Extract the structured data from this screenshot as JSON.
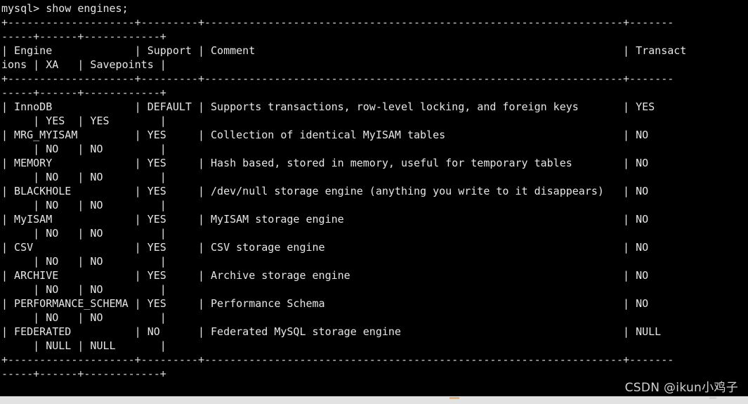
{
  "terminal": {
    "prompt_line": "mysql> show engines;",
    "columns": 106,
    "background_color": "#000000",
    "text_color": "#e6e6e6",
    "rule_color": "#d8d8d8",
    "separator_full": "+--------------------+---------+----------------------------------------------------------------+--------------+------+------------+",
    "header_cells": [
      "Engine",
      "Support",
      "Comment",
      "Transactions",
      "XA",
      "Savepoints"
    ],
    "header_line": "| Engine             | Support | Comment                                                        | Transactions | XA   | Savepoints |",
    "rows": [
      {
        "engine": "InnoDB",
        "support": "DEFAULT",
        "comment": "Supports transactions, row-level locking, and foreign keys",
        "transactions": "YES",
        "xa": "YES",
        "savepoints": "YES",
        "line": "| InnoDB             | DEFAULT | Supports transactions, row-level locking, and foreign keys     | YES          | YES  | YES        |"
      },
      {
        "engine": "MRG_MYISAM",
        "support": "YES",
        "comment": "Collection of identical MyISAM tables",
        "transactions": "NO",
        "xa": "NO",
        "savepoints": "NO",
        "line": "| MRG_MYISAM         | YES     | Collection of identical MyISAM tables                          | NO           | NO   | NO         |"
      },
      {
        "engine": "MEMORY",
        "support": "YES",
        "comment": "Hash based, stored in memory, useful for temporary tables",
        "transactions": "NO",
        "xa": "NO",
        "savepoints": "NO",
        "line": "| MEMORY             | YES     | Hash based, stored in memory, useful for temporary tables      | NO           | NO   | NO         |"
      },
      {
        "engine": "BLACKHOLE",
        "support": "YES",
        "comment": "/dev/null storage engine (anything you write to it disappears)",
        "transactions": "NO",
        "xa": "NO",
        "savepoints": "NO",
        "line": "| BLACKHOLE          | YES     | /dev/null storage engine (anything you write to it disappears) | NO           | NO   | NO         |"
      },
      {
        "engine": "MyISAM",
        "support": "YES",
        "comment": "MyISAM storage engine",
        "transactions": "NO",
        "xa": "NO",
        "savepoints": "NO",
        "line": "| MyISAM             | YES     | MyISAM storage engine                                          | NO           | NO   | NO         |"
      },
      {
        "engine": "CSV",
        "support": "YES",
        "comment": "CSV storage engine",
        "transactions": "NO",
        "xa": "NO",
        "savepoints": "NO",
        "line": "| CSV                | YES     | CSV storage engine                                             | NO           | NO   | NO         |"
      },
      {
        "engine": "ARCHIVE",
        "support": "YES",
        "comment": "Archive storage engine",
        "transactions": "NO",
        "xa": "NO",
        "savepoints": "NO",
        "line": "| ARCHIVE            | YES     | Archive storage engine                                         | NO           | NO   | NO         |"
      },
      {
        "engine": "PERFORMANCE_SCHEMA",
        "support": "YES",
        "comment": "Performance Schema",
        "transactions": "NO",
        "xa": "NO",
        "savepoints": "NO",
        "line": "| PERFORMANCE_SCHEMA | YES     | Performance Schema                                             | NO           | NO   | NO         |"
      },
      {
        "engine": "FEDERATED",
        "support": "NO",
        "comment": "Federated MySQL storage engine",
        "transactions": "NULL",
        "xa": "NULL",
        "savepoints": "NULL",
        "line": "| FEDERATED          | NO      | Federated MySQL storage engine                                 | NULL         | NULL | NULL       |"
      }
    ],
    "wrapped_lines": [
      "mysql> show engines;",
      "+--------------------+---------+-------------------------------------------------------",
      "-----+--------------+------+------------+",
      "| Engine             | Support | Comment                                                ",
      "ions | XA   | Savepoints |",
      "+--------------------+---------+-------------------------------------------------------",
      "-----+--------------+------+------------+",
      "| InnoDB             | DEFAULT | Supports transactions, row-level locking, and foreign k",
      "    | YES  | YES        |",
      "| MRG_MYISAM         | YES     | Collection of identical MyISAM tables                  ",
      "    | NO   | NO         |",
      "| MEMORY             | YES     | Hash based, stored in memory, useful for temporary tabl",
      "    | NO   | NO         |",
      "| BLACKHOLE          | YES     | /dev/null storage engine (anything you write to it disa",
      "    | NO   | NO         |",
      "| MyISAM             | YES     | MyISAM storage engine                                  ",
      "    | NO   | NO         |",
      "| CSV                | YES     | CSV storage engine                                     ",
      "    | NO   | NO         |",
      "| ARCHIVE            | YES     | Archive storage engine                                 ",
      "    | NO   | NO         |",
      "| PERFORMANCE_SCHEMA | YES     | Performance Schema                                     ",
      "    | NO   | NO         |",
      "| FEDERATED          | NO      | Federated MySQL storage engine                         ",
      "    | NULL | NULL       |",
      "+--------------------+---------+-------------------------------------------------------",
      "-----+--------------+------+------------+"
    ],
    "display_lines": [
      {
        "id": "line-prompt",
        "text": "mysql> show engines;",
        "kind": "prompt"
      },
      {
        "id": "line-rule-top-a",
        "text": "+--------------------+---------+------------------------------------------------------------------+-------",
        "kind": "rule"
      },
      {
        "id": "line-rule-top-b",
        "text": "-----+------+------------+",
        "kind": "rule"
      },
      {
        "id": "line-head-a",
        "text": "| Engine             | Support | Comment                                                          | Transact",
        "kind": "text"
      },
      {
        "id": "line-head-b",
        "text": "ions | XA   | Savepoints |",
        "kind": "text"
      },
      {
        "id": "line-rule-mid-a",
        "text": "+--------------------+---------+------------------------------------------------------------------+-------",
        "kind": "rule"
      },
      {
        "id": "line-rule-mid-b",
        "text": "-----+------+------------+",
        "kind": "rule"
      },
      {
        "id": "line-innodb-a",
        "text": "| InnoDB             | DEFAULT | Supports transactions, row-level locking, and foreign keys       | YES",
        "kind": "text"
      },
      {
        "id": "line-innodb-b",
        "text": "     | YES  | YES        |",
        "kind": "text"
      },
      {
        "id": "line-mrg-a",
        "text": "| MRG_MYISAM         | YES     | Collection of identical MyISAM tables                            | NO",
        "kind": "text"
      },
      {
        "id": "line-mrg-b",
        "text": "     | NO   | NO         |",
        "kind": "text"
      },
      {
        "id": "line-memory-a",
        "text": "| MEMORY             | YES     | Hash based, stored in memory, useful for temporary tables        | NO",
        "kind": "text"
      },
      {
        "id": "line-memory-b",
        "text": "     | NO   | NO         |",
        "kind": "text"
      },
      {
        "id": "line-blackhole-a",
        "text": "| BLACKHOLE          | YES     | /dev/null storage engine (anything you write to it disappears)   | NO",
        "kind": "text"
      },
      {
        "id": "line-blackhole-b",
        "text": "     | NO   | NO         |",
        "kind": "text"
      },
      {
        "id": "line-myisam-a",
        "text": "| MyISAM             | YES     | MyISAM storage engine                                            | NO",
        "kind": "text"
      },
      {
        "id": "line-myisam-b",
        "text": "     | NO   | NO         |",
        "kind": "text"
      },
      {
        "id": "line-csv-a",
        "text": "| CSV                | YES     | CSV storage engine                                               | NO",
        "kind": "text"
      },
      {
        "id": "line-csv-b",
        "text": "     | NO   | NO         |",
        "kind": "text"
      },
      {
        "id": "line-archive-a",
        "text": "| ARCHIVE            | YES     | Archive storage engine                                           | NO",
        "kind": "text"
      },
      {
        "id": "line-archive-b",
        "text": "     | NO   | NO         |",
        "kind": "text"
      },
      {
        "id": "line-perf-a",
        "text": "| PERFORMANCE_SCHEMA | YES     | Performance Schema                                               | NO",
        "kind": "text"
      },
      {
        "id": "line-perf-b",
        "text": "     | NO   | NO         |",
        "kind": "text"
      },
      {
        "id": "line-fed-a",
        "text": "| FEDERATED          | NO      | Federated MySQL storage engine                                   | NULL",
        "kind": "text"
      },
      {
        "id": "line-fed-b",
        "text": "     | NULL | NULL       |",
        "kind": "text"
      },
      {
        "id": "line-rule-bot-a",
        "text": "+--------------------+---------+------------------------------------------------------------------+-------",
        "kind": "rule"
      },
      {
        "id": "line-rule-bot-b",
        "text": "-----+------+------------+",
        "kind": "rule"
      }
    ]
  },
  "watermark": {
    "text": "CSDN @ikun小鸡子"
  }
}
